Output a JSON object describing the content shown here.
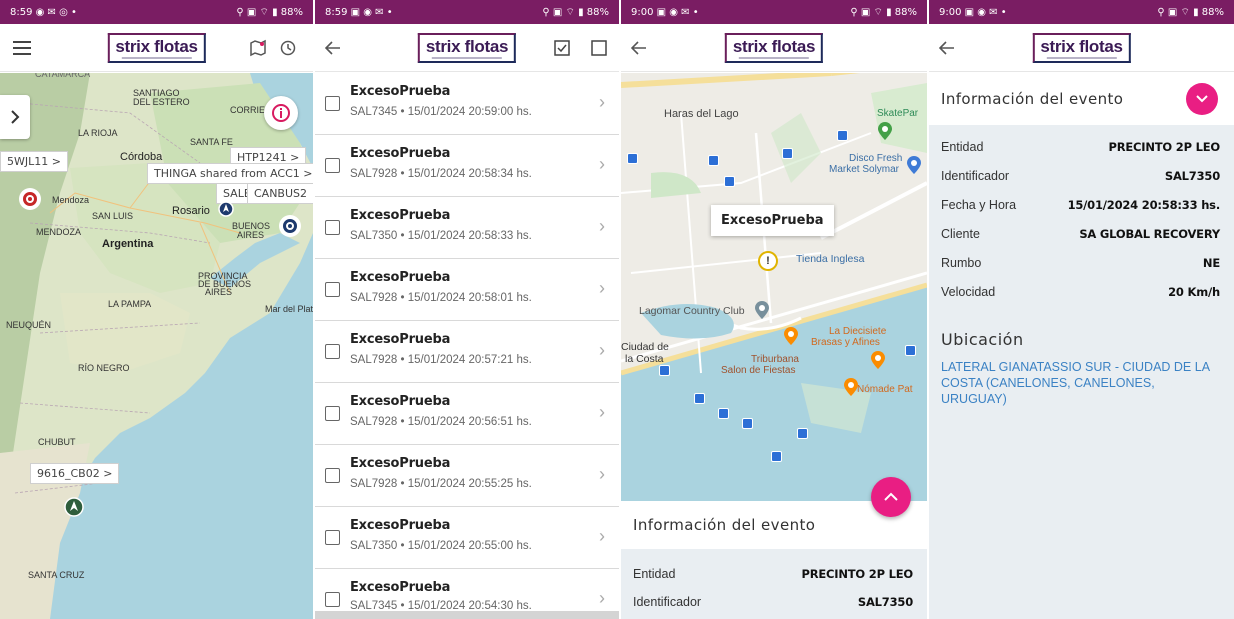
{
  "screens": [
    {
      "status_time": "8:59 ◉ ✉ ◎ •",
      "status_right": "⚲ ▣ ⌔ ▮ 88%",
      "brand": "strix flotas",
      "map": {
        "unit_labels": [
          "5WJL11 >",
          "HTP1241 >",
          "THINGA shared from ACC1 >",
          "SALE",
          "CANBUS2",
          "9616_CB02 >"
        ],
        "place_labels": [
          "SANTIAGO DEL ESTERO",
          "LA RIOJA",
          "CORRIEN",
          "SANTA FE",
          "Córdoba",
          "Mendoza",
          "SAN LUIS",
          "Rosario",
          "MENDOZA",
          "Argentina",
          "BUENOS AIRES",
          "PROVINCIA DE BUENOS AIRES",
          "LA PAMPA",
          "Mar del Plat",
          "NEUQUÉN",
          "RÍO NEGRO",
          "CHUBUT",
          "SANTA CRUZ",
          "CATAMARCA"
        ]
      }
    },
    {
      "status_time": "8:59 ▣ ◉ ✉ •",
      "status_right": "⚲ ▣ ⌔ ▮ 88%",
      "brand": "strix flotas",
      "events": [
        {
          "name": "ExcesoPrueba",
          "detail": "SAL7345 • 15/01/2024 20:59:00 hs."
        },
        {
          "name": "ExcesoPrueba",
          "detail": "SAL7928 • 15/01/2024 20:58:34 hs."
        },
        {
          "name": "ExcesoPrueba",
          "detail": "SAL7350 • 15/01/2024 20:58:33 hs."
        },
        {
          "name": "ExcesoPrueba",
          "detail": "SAL7928 • 15/01/2024 20:58:01 hs."
        },
        {
          "name": "ExcesoPrueba",
          "detail": "SAL7928 • 15/01/2024 20:57:21 hs."
        },
        {
          "name": "ExcesoPrueba",
          "detail": "SAL7928 • 15/01/2024 20:56:51 hs."
        },
        {
          "name": "ExcesoPrueba",
          "detail": "SAL7928 • 15/01/2024 20:55:25 hs."
        },
        {
          "name": "ExcesoPrueba",
          "detail": "SAL7350 • 15/01/2024 20:55:00 hs."
        },
        {
          "name": "ExcesoPrueba",
          "detail": "SAL7345 • 15/01/2024 20:54:30 hs."
        }
      ]
    },
    {
      "status_time": "9:00 ▣ ◉ ✉ •",
      "status_right": "⚲ ▣ ⌔ ▮ 88%",
      "brand": "strix flotas",
      "map": {
        "callout": "ExcesoPrueba",
        "places": [
          "Haras del Lago",
          "SkatePar",
          "Disco Fresh Market Solymar",
          "Tienda Inglesa",
          "Lagomar Country Club",
          "Ciudad de la Costa",
          "La Diecisiete Brasas y Afines",
          "Triburbana Salon de Fiestas",
          "Nómade Pat"
        ]
      },
      "panel": {
        "title": "Información del evento",
        "rows": [
          {
            "key": "Entidad",
            "value": "PRECINTO 2P LEO"
          },
          {
            "key": "Identificador",
            "value": "SAL7350"
          }
        ]
      }
    },
    {
      "status_time": "9:00 ▣ ◉ ✉ •",
      "status_right": "⚲ ▣ ⌔ ▮ 88%",
      "brand": "strix flotas",
      "title": "Información del evento",
      "rows": [
        {
          "key": "Entidad",
          "value": "PRECINTO 2P LEO"
        },
        {
          "key": "Identificador",
          "value": "SAL7350"
        },
        {
          "key": "Fecha y Hora",
          "value": "15/01/2024 20:58:33 hs."
        },
        {
          "key": "Cliente",
          "value": "SA GLOBAL RECOVERY"
        },
        {
          "key": "Rumbo",
          "value": "NE"
        },
        {
          "key": "Velocidad",
          "value": "20 Km/h"
        }
      ],
      "location_title": "Ubicación",
      "location_text": "LATERAL GIANATASSIO SUR - CIUDAD DE LA COSTA (CANELONES, CANELONES, URUGUAY)"
    }
  ],
  "colors": {
    "status_bar": "#7a1d63",
    "accent": "#e91e83",
    "link": "#3b82c4",
    "panel_bg": "#e9eef2"
  }
}
